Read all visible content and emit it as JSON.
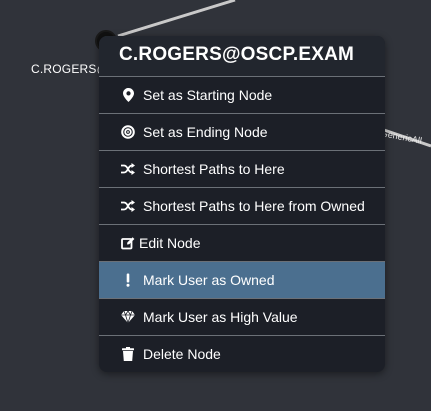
{
  "graph": {
    "node_label": "C.ROGERS@",
    "edge_label": "GenericAll",
    "node_status_color": "#37c237",
    "edge_color": "#c9c9c9"
  },
  "context_menu": {
    "title": "C.ROGERS@OSCP.EXAM",
    "active_color": "#4b6f8f",
    "items": [
      {
        "label": "Set as Starting Node",
        "icon": "map-marker-icon"
      },
      {
        "label": "Set as Ending Node",
        "icon": "bullseye-icon"
      },
      {
        "label": "Shortest Paths to Here",
        "icon": "random-icon"
      },
      {
        "label": "Shortest Paths to Here from Owned",
        "icon": "random-icon"
      },
      {
        "label": "Edit Node",
        "icon": "edit-icon"
      },
      {
        "label": "Mark User as Owned",
        "icon": "exclamation-icon",
        "active": true
      },
      {
        "label": "Mark User as High Value",
        "icon": "gem-icon"
      },
      {
        "label": "Delete Node",
        "icon": "trash-icon"
      }
    ]
  }
}
